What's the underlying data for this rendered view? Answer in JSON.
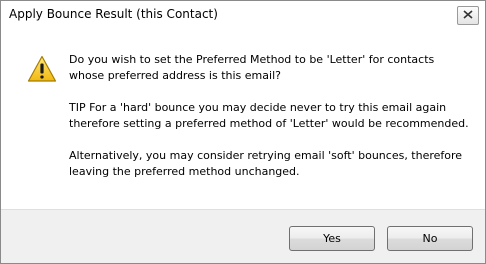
{
  "window": {
    "title": "Apply Bounce Result (this Contact)",
    "close_icon": "close-icon"
  },
  "message": {
    "icon": "warning-icon",
    "paragraphs": [
      "Do you wish to set the Preferred Method to be 'Letter' for contacts whose preferred address is this email?",
      "TIP For a 'hard' bounce you may decide never to try this email again therefore setting a preferred method of 'Letter' would be recommended.",
      "Alternatively, you may consider retrying email 'soft' bounces, therefore leaving the preferred method unchanged."
    ]
  },
  "buttons": {
    "yes_label": "Yes",
    "no_label": "No"
  },
  "colors": {
    "warning_yellow": "#f5c518",
    "content_bg": "#ffffff",
    "footer_bg": "#f0f0f0"
  }
}
